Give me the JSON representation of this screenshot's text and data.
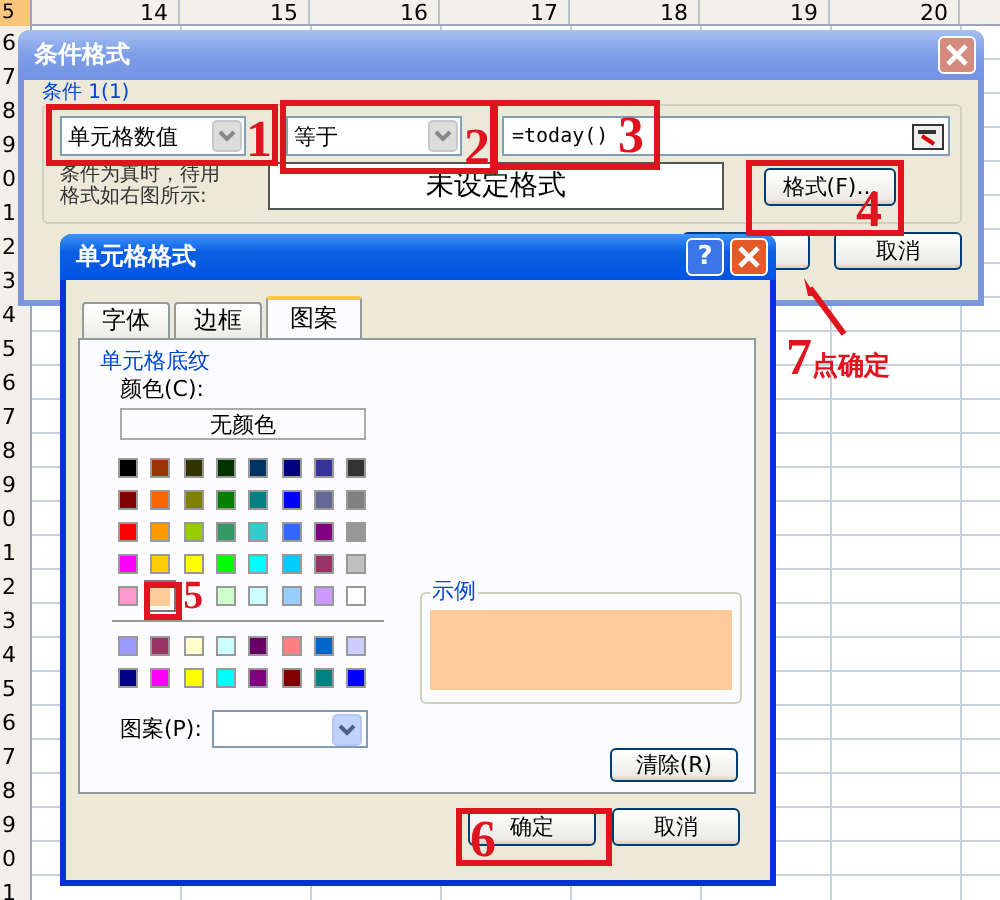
{
  "spreadsheet": {
    "column_headers": [
      "14",
      "15",
      "16",
      "17",
      "18",
      "19",
      "20"
    ],
    "row_headers": [
      "5",
      "6",
      "7",
      "8",
      "9",
      "0",
      "1",
      "2",
      "3",
      "4",
      "5",
      "6",
      "7",
      "8",
      "9",
      "0",
      "1",
      "2",
      "3",
      "4",
      "5",
      "6",
      "7",
      "8",
      "9",
      "0",
      "1"
    ]
  },
  "conditional_format_dialog": {
    "title": "条件格式",
    "condition_label": "条件 1(1)",
    "operand_type": "单元格数值",
    "operator": "等于",
    "formula": "=today()",
    "preview_caption": "条件为真时，待用格式如右图所示:",
    "preview_text": "未设定格式",
    "format_button": "格式(F)...",
    "cancel_button": "取消"
  },
  "cell_format_dialog": {
    "title": "单元格格式",
    "help_button": "?",
    "tabs": [
      {
        "label": "字体",
        "selected": false
      },
      {
        "label": "边框",
        "selected": false
      },
      {
        "label": "图案",
        "selected": true
      }
    ],
    "shading_group": "单元格底纹",
    "color_label": "颜色(C):",
    "no_color_button": "无颜色",
    "standard_colors": [
      {
        "color": "#000000",
        "selected": false
      },
      {
        "color": "#993300",
        "selected": false
      },
      {
        "color": "#333300",
        "selected": false
      },
      {
        "color": "#003300",
        "selected": false
      },
      {
        "color": "#003366",
        "selected": false
      },
      {
        "color": "#000080",
        "selected": false
      },
      {
        "color": "#333399",
        "selected": false
      },
      {
        "color": "#333333",
        "selected": false
      },
      {
        "color": "#800000",
        "selected": false
      },
      {
        "color": "#ff6600",
        "selected": false
      },
      {
        "color": "#808000",
        "selected": false
      },
      {
        "color": "#008000",
        "selected": false
      },
      {
        "color": "#008080",
        "selected": false
      },
      {
        "color": "#0000ff",
        "selected": false
      },
      {
        "color": "#666699",
        "selected": false
      },
      {
        "color": "#808080",
        "selected": false
      },
      {
        "color": "#ff0000",
        "selected": false
      },
      {
        "color": "#ff9900",
        "selected": false
      },
      {
        "color": "#99cc00",
        "selected": false
      },
      {
        "color": "#339966",
        "selected": false
      },
      {
        "color": "#33cccc",
        "selected": false
      },
      {
        "color": "#3366ff",
        "selected": false
      },
      {
        "color": "#800080",
        "selected": false
      },
      {
        "color": "#969696",
        "selected": false
      },
      {
        "color": "#ff00ff",
        "selected": false
      },
      {
        "color": "#ffcc00",
        "selected": false
      },
      {
        "color": "#ffff00",
        "selected": false
      },
      {
        "color": "#00ff00",
        "selected": false
      },
      {
        "color": "#00ffff",
        "selected": false
      },
      {
        "color": "#00ccff",
        "selected": false
      },
      {
        "color": "#993366",
        "selected": false
      },
      {
        "color": "#c0c0c0",
        "selected": false
      },
      {
        "color": "#ff99cc",
        "selected": false
      },
      {
        "color": "#ffcc99",
        "selected": true
      },
      {
        "color": "#ccffcc",
        "selected": false
      },
      {
        "color": "#ccffff",
        "selected": false
      },
      {
        "color": "#99ccff",
        "selected": false
      },
      {
        "color": "#cc99ff",
        "selected": false
      },
      {
        "color": "#ffffff",
        "selected": false
      }
    ],
    "chart_colors": [
      {
        "color": "#9999ff",
        "selected": false
      },
      {
        "color": "#993366",
        "selected": false
      },
      {
        "color": "#ffffcc",
        "selected": false
      },
      {
        "color": "#ccffff",
        "selected": false
      },
      {
        "color": "#660066",
        "selected": false
      },
      {
        "color": "#ff8080",
        "selected": false
      },
      {
        "color": "#0066cc",
        "selected": false
      },
      {
        "color": "#ccccff",
        "selected": false
      },
      {
        "color": "#000080",
        "selected": false
      },
      {
        "color": "#ff00ff",
        "selected": false
      },
      {
        "color": "#ffff00",
        "selected": false
      },
      {
        "color": "#00ffff",
        "selected": false
      },
      {
        "color": "#800080",
        "selected": false
      },
      {
        "color": "#800000",
        "selected": false
      },
      {
        "color": "#008080",
        "selected": false
      },
      {
        "color": "#0000ff",
        "selected": false
      }
    ],
    "pattern_label": "图案(P):",
    "sample_label": "示例",
    "clear_button": "清除(R)",
    "ok_button": "确定",
    "cancel_button": "取消"
  },
  "annotations": [
    {
      "number": "1"
    },
    {
      "number": "2"
    },
    {
      "number": "3"
    },
    {
      "number": "4"
    },
    {
      "number": "5"
    },
    {
      "number": "6"
    },
    {
      "number": "7",
      "text": "点确定"
    }
  ]
}
